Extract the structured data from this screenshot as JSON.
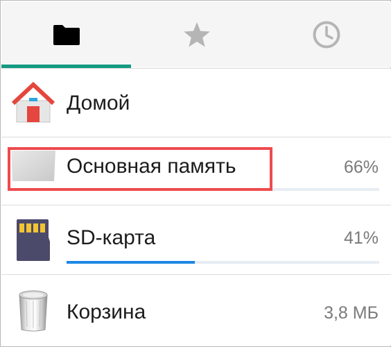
{
  "tabs": [
    {
      "name": "files",
      "icon": "folder-icon",
      "active": true,
      "color": "#000000"
    },
    {
      "name": "favorites",
      "icon": "star-icon",
      "active": false,
      "color": "#b5b5b5"
    },
    {
      "name": "recent",
      "icon": "clock-icon",
      "active": false,
      "color": "#b5b5b5"
    }
  ],
  "accent_color": "#139a82",
  "locations": [
    {
      "id": "home",
      "label": "Домой",
      "value": "",
      "icon": "home-icon"
    },
    {
      "id": "internal",
      "label": "Основная память",
      "value": "66%",
      "icon": "internal-storage-icon",
      "usage": 0.66,
      "highlighted": true
    },
    {
      "id": "sd",
      "label": "SD-карта",
      "value": "41%",
      "icon": "sd-card-icon",
      "usage": 0.41
    },
    {
      "id": "trash",
      "label": "Корзина",
      "value": "3,8 МБ",
      "icon": "trash-icon"
    }
  ],
  "usage_bar_color": "#1e88e5",
  "highlight_color": "#ee4a4e"
}
